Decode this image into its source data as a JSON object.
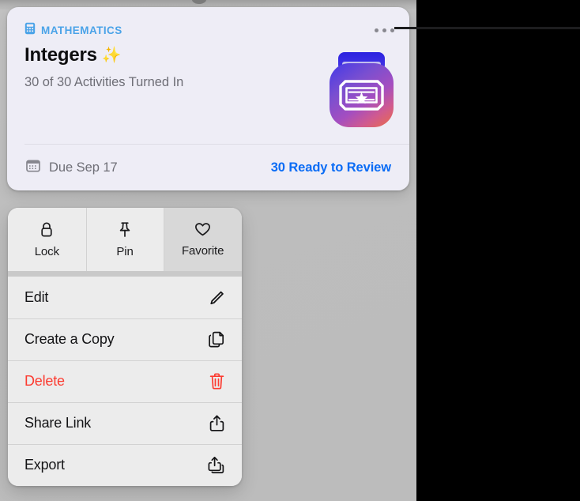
{
  "card": {
    "subject": "MATHEMATICS",
    "subject_icon": "calculator-icon",
    "title": "Integers",
    "title_emoji": "✨",
    "progress": "30 of 30 Activities Turned In",
    "more_icon": "ellipsis-icon",
    "app_icon": "schoolwork-app-icon",
    "due_icon": "calendar-icon",
    "due": "Due Sep 17",
    "review_link": "30 Ready to Review"
  },
  "menu": {
    "quick_actions": [
      {
        "label": "Lock",
        "icon": "lock-icon",
        "active": false
      },
      {
        "label": "Pin",
        "icon": "pin-icon",
        "active": false
      },
      {
        "label": "Favorite",
        "icon": "heart-icon",
        "active": true
      }
    ],
    "items": [
      {
        "label": "Edit",
        "icon": "pencil-icon",
        "destructive": false
      },
      {
        "label": "Create a Copy",
        "icon": "duplicate-icon",
        "destructive": false
      },
      {
        "label": "Delete",
        "icon": "trash-icon",
        "destructive": true
      },
      {
        "label": "Share Link",
        "icon": "share-icon",
        "destructive": false
      },
      {
        "label": "Export",
        "icon": "export-icon",
        "destructive": false
      }
    ]
  },
  "colors": {
    "subject_blue": "#4aa3e8",
    "link_blue": "#0a6cf5",
    "destructive_red": "#fc3b30",
    "card_bg": "#eeedf6",
    "menu_bg": "#ececec",
    "backdrop": "#bdbdbd"
  }
}
